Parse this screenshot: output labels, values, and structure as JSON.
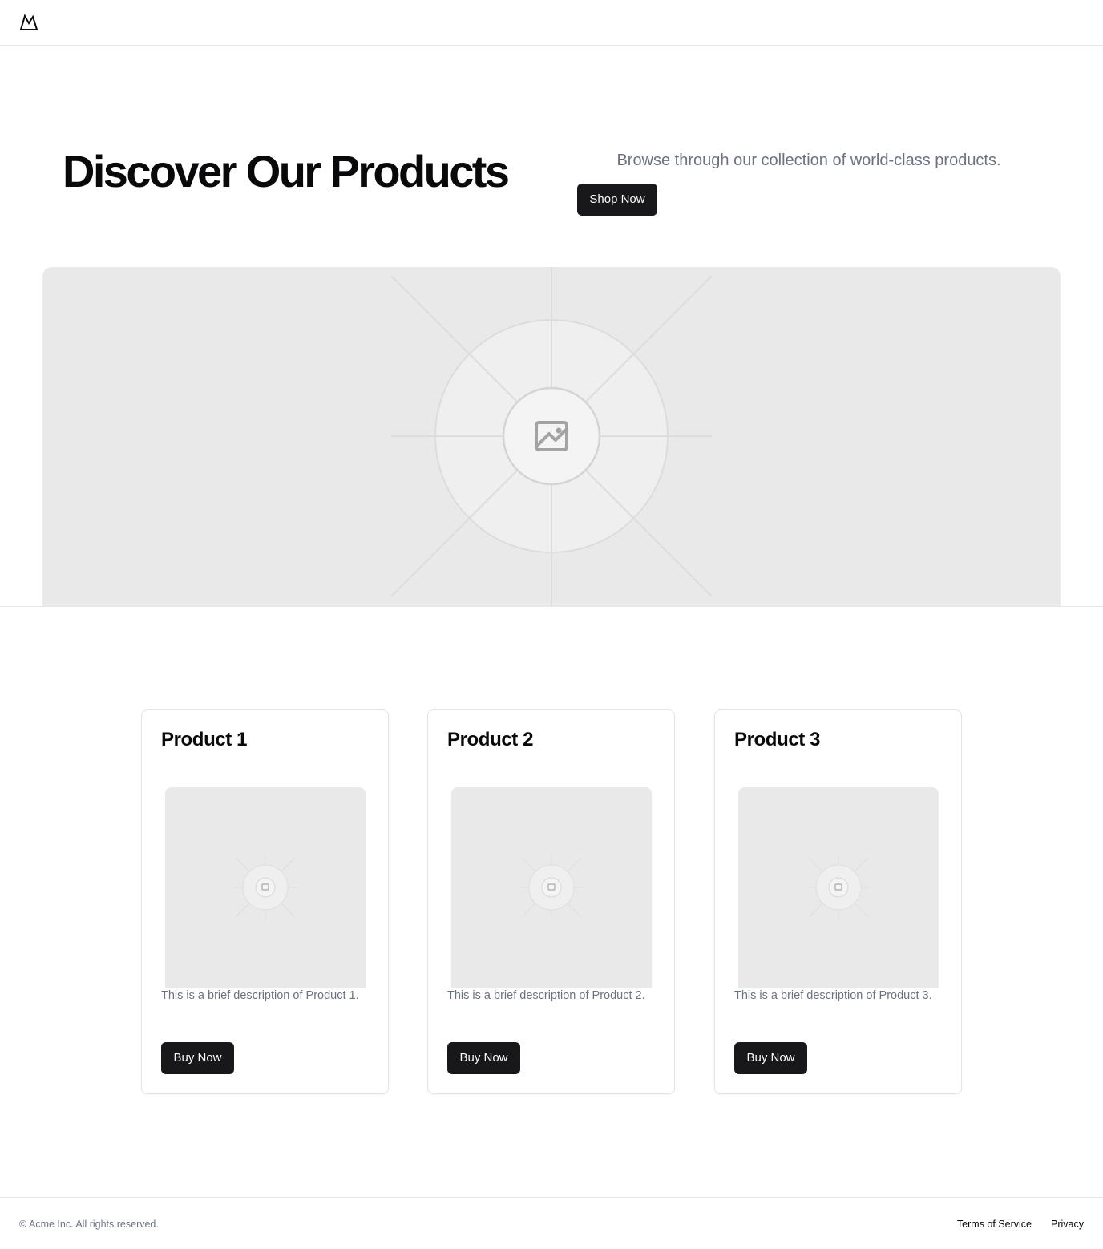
{
  "header": {
    "logo_icon": "mountain-icon"
  },
  "hero": {
    "title": "Discover Our Products",
    "subtitle": "Browse through our collection of world-class products.",
    "cta_label": "Shop Now",
    "image_icon": "image-placeholder-icon"
  },
  "products": [
    {
      "title": "Product 1",
      "description": "This is a brief description of Product 1.",
      "button_label": "Buy Now",
      "image_icon": "image-placeholder-icon"
    },
    {
      "title": "Product 2",
      "description": "This is a brief description of Product 2.",
      "button_label": "Buy Now",
      "image_icon": "image-placeholder-icon"
    },
    {
      "title": "Product 3",
      "description": "This is a brief description of Product 3.",
      "button_label": "Buy Now",
      "image_icon": "image-placeholder-icon"
    }
  ],
  "footer": {
    "copyright": "© Acme Inc. All rights reserved.",
    "links": [
      "Terms of Service",
      "Privacy"
    ]
  },
  "colors": {
    "button_bg": "#18181b",
    "button_text": "#fafafa",
    "muted_text": "#6b7280",
    "placeholder_bg": "#e9e9e9",
    "border": "#e5e7eb"
  }
}
